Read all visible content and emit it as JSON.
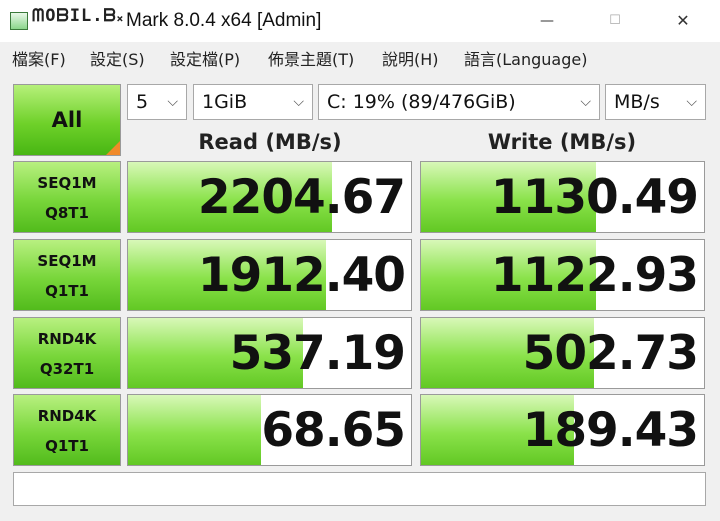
{
  "window": {
    "watermark": "ᗰOᗷIL.ᗷ᙮",
    "title": "Mark 8.0.4 x64 [Admin]",
    "min_glyph": "—",
    "max_glyph": "☐",
    "close_glyph": "✕"
  },
  "menu": [
    {
      "label": "檔案(F)"
    },
    {
      "label": "設定(S)"
    },
    {
      "label": "設定檔(P)"
    },
    {
      "label": "佈景主題(T)"
    },
    {
      "label": "說明(H)"
    },
    {
      "label": "語言(Language)"
    }
  ],
  "controls": {
    "all_label": "All",
    "count": "5",
    "size": "1GiB",
    "drive": "C: 19% (89/476GiB)",
    "unit": "MB/s",
    "chevron": "⌵"
  },
  "headers": {
    "read": "Read (MB/s)",
    "write": "Write (MB/s)"
  },
  "tests": [
    {
      "line1": "SEQ1M",
      "line2": "Q8T1",
      "read": "2204.67",
      "write": "1130.49",
      "read_fill": 0.72,
      "write_fill": 0.62
    },
    {
      "line1": "SEQ1M",
      "line2": "Q1T1",
      "read": "1912.40",
      "write": "1122.93",
      "read_fill": 0.7,
      "write_fill": 0.62
    },
    {
      "line1": "RND4K",
      "line2": "Q32T1",
      "read": "537.19",
      "write": "502.73",
      "read_fill": 0.62,
      "write_fill": 0.61
    },
    {
      "line1": "RND4K",
      "line2": "Q1T1",
      "read": "68.65",
      "write": "189.43",
      "read_fill": 0.47,
      "write_fill": 0.54
    }
  ],
  "comment": ""
}
